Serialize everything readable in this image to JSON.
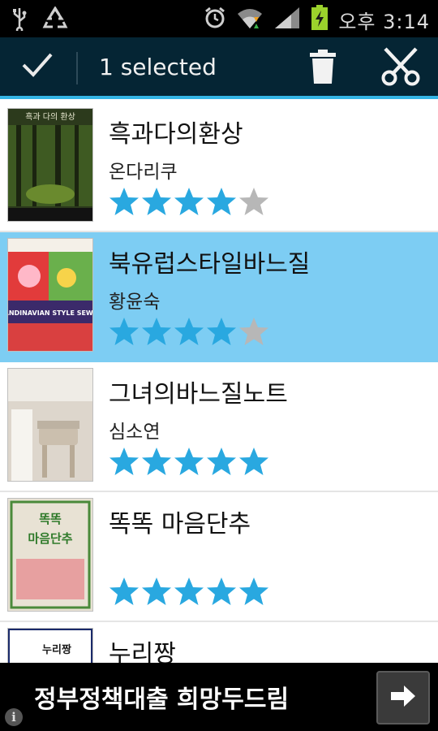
{
  "status_bar": {
    "time": "오후 3:14",
    "icons": [
      "usb-icon",
      "recycle-icon",
      "alarm-icon",
      "wifi-icon",
      "signal-icon",
      "battery-charging-icon"
    ]
  },
  "action_bar": {
    "selection_title": "1 selected",
    "done_icon": "checkmark-icon",
    "delete_icon": "trash-icon",
    "cut_icon": "scissors-icon",
    "bg_color": "#052534",
    "accent_color": "#34b5e5"
  },
  "books": [
    {
      "title": "흑과다의환상",
      "author": "온다리쿠",
      "rating": 4,
      "max_rating": 5,
      "selected": false,
      "cover_text": "흑과 다의 환상"
    },
    {
      "title": "북유럽스타일바느질",
      "author": "황윤숙",
      "rating": 4,
      "max_rating": 5,
      "selected": true,
      "cover_text": "SCANDINAVIAN STYLE SEWING"
    },
    {
      "title": "그녀의바느질노트",
      "author": "심소연",
      "rating": 5,
      "max_rating": 5,
      "selected": false,
      "cover_text": ""
    },
    {
      "title": "똑똑 마음단추",
      "author": "",
      "rating": 5,
      "max_rating": 5,
      "selected": false,
      "cover_text": "똑똑 마음단추"
    },
    {
      "title": "누리짱",
      "author": "",
      "rating": 0,
      "max_rating": 5,
      "selected": false,
      "cover_text": "누리짱"
    }
  ],
  "colors": {
    "star_filled": "#29a8e0",
    "star_empty": "#b7b7b7",
    "selected_row": "#7dcdf3"
  },
  "ad_banner": {
    "text": "정부정책대출 희망두드림",
    "info_label": "i",
    "arrow_icon": "arrow-right-icon"
  }
}
